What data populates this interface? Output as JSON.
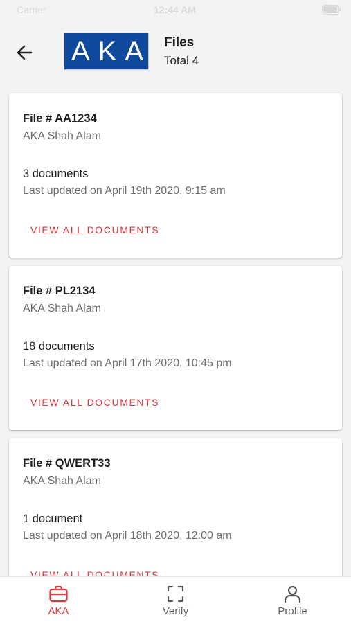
{
  "status_bar": {
    "carrier": "Carrier",
    "time": "12:44 AM"
  },
  "header": {
    "logo_text": "AKA",
    "title": "Files",
    "subtitle": "Total 4",
    "back_icon": "arrow-left-icon"
  },
  "files": [
    {
      "file_no": "File # AA1234",
      "owner": "AKA Shah Alam",
      "doc_count": "3 documents",
      "updated": "Last updated on April 19th 2020, 9:15 am",
      "action": "VIEW ALL DOCUMENTS"
    },
    {
      "file_no": "File # PL2134",
      "owner": "AKA Shah Alam",
      "doc_count": "18 documents",
      "updated": "Last updated on April 17th 2020, 10:45 pm",
      "action": "VIEW ALL DOCUMENTS"
    },
    {
      "file_no": "File # QWERT33",
      "owner": "AKA Shah Alam",
      "doc_count": "1 document",
      "updated": "Last updated on April 18th 2020, 12:00 am",
      "action": "VIEW ALL DOCUMENTS"
    }
  ],
  "tabs": [
    {
      "label": "AKA",
      "icon": "briefcase-icon",
      "active": true
    },
    {
      "label": "Verify",
      "icon": "scan-frame-icon",
      "active": false
    },
    {
      "label": "Profile",
      "icon": "person-icon",
      "active": false
    }
  ],
  "colors": {
    "accent": "#e0363c",
    "brand": "#114a9c"
  }
}
